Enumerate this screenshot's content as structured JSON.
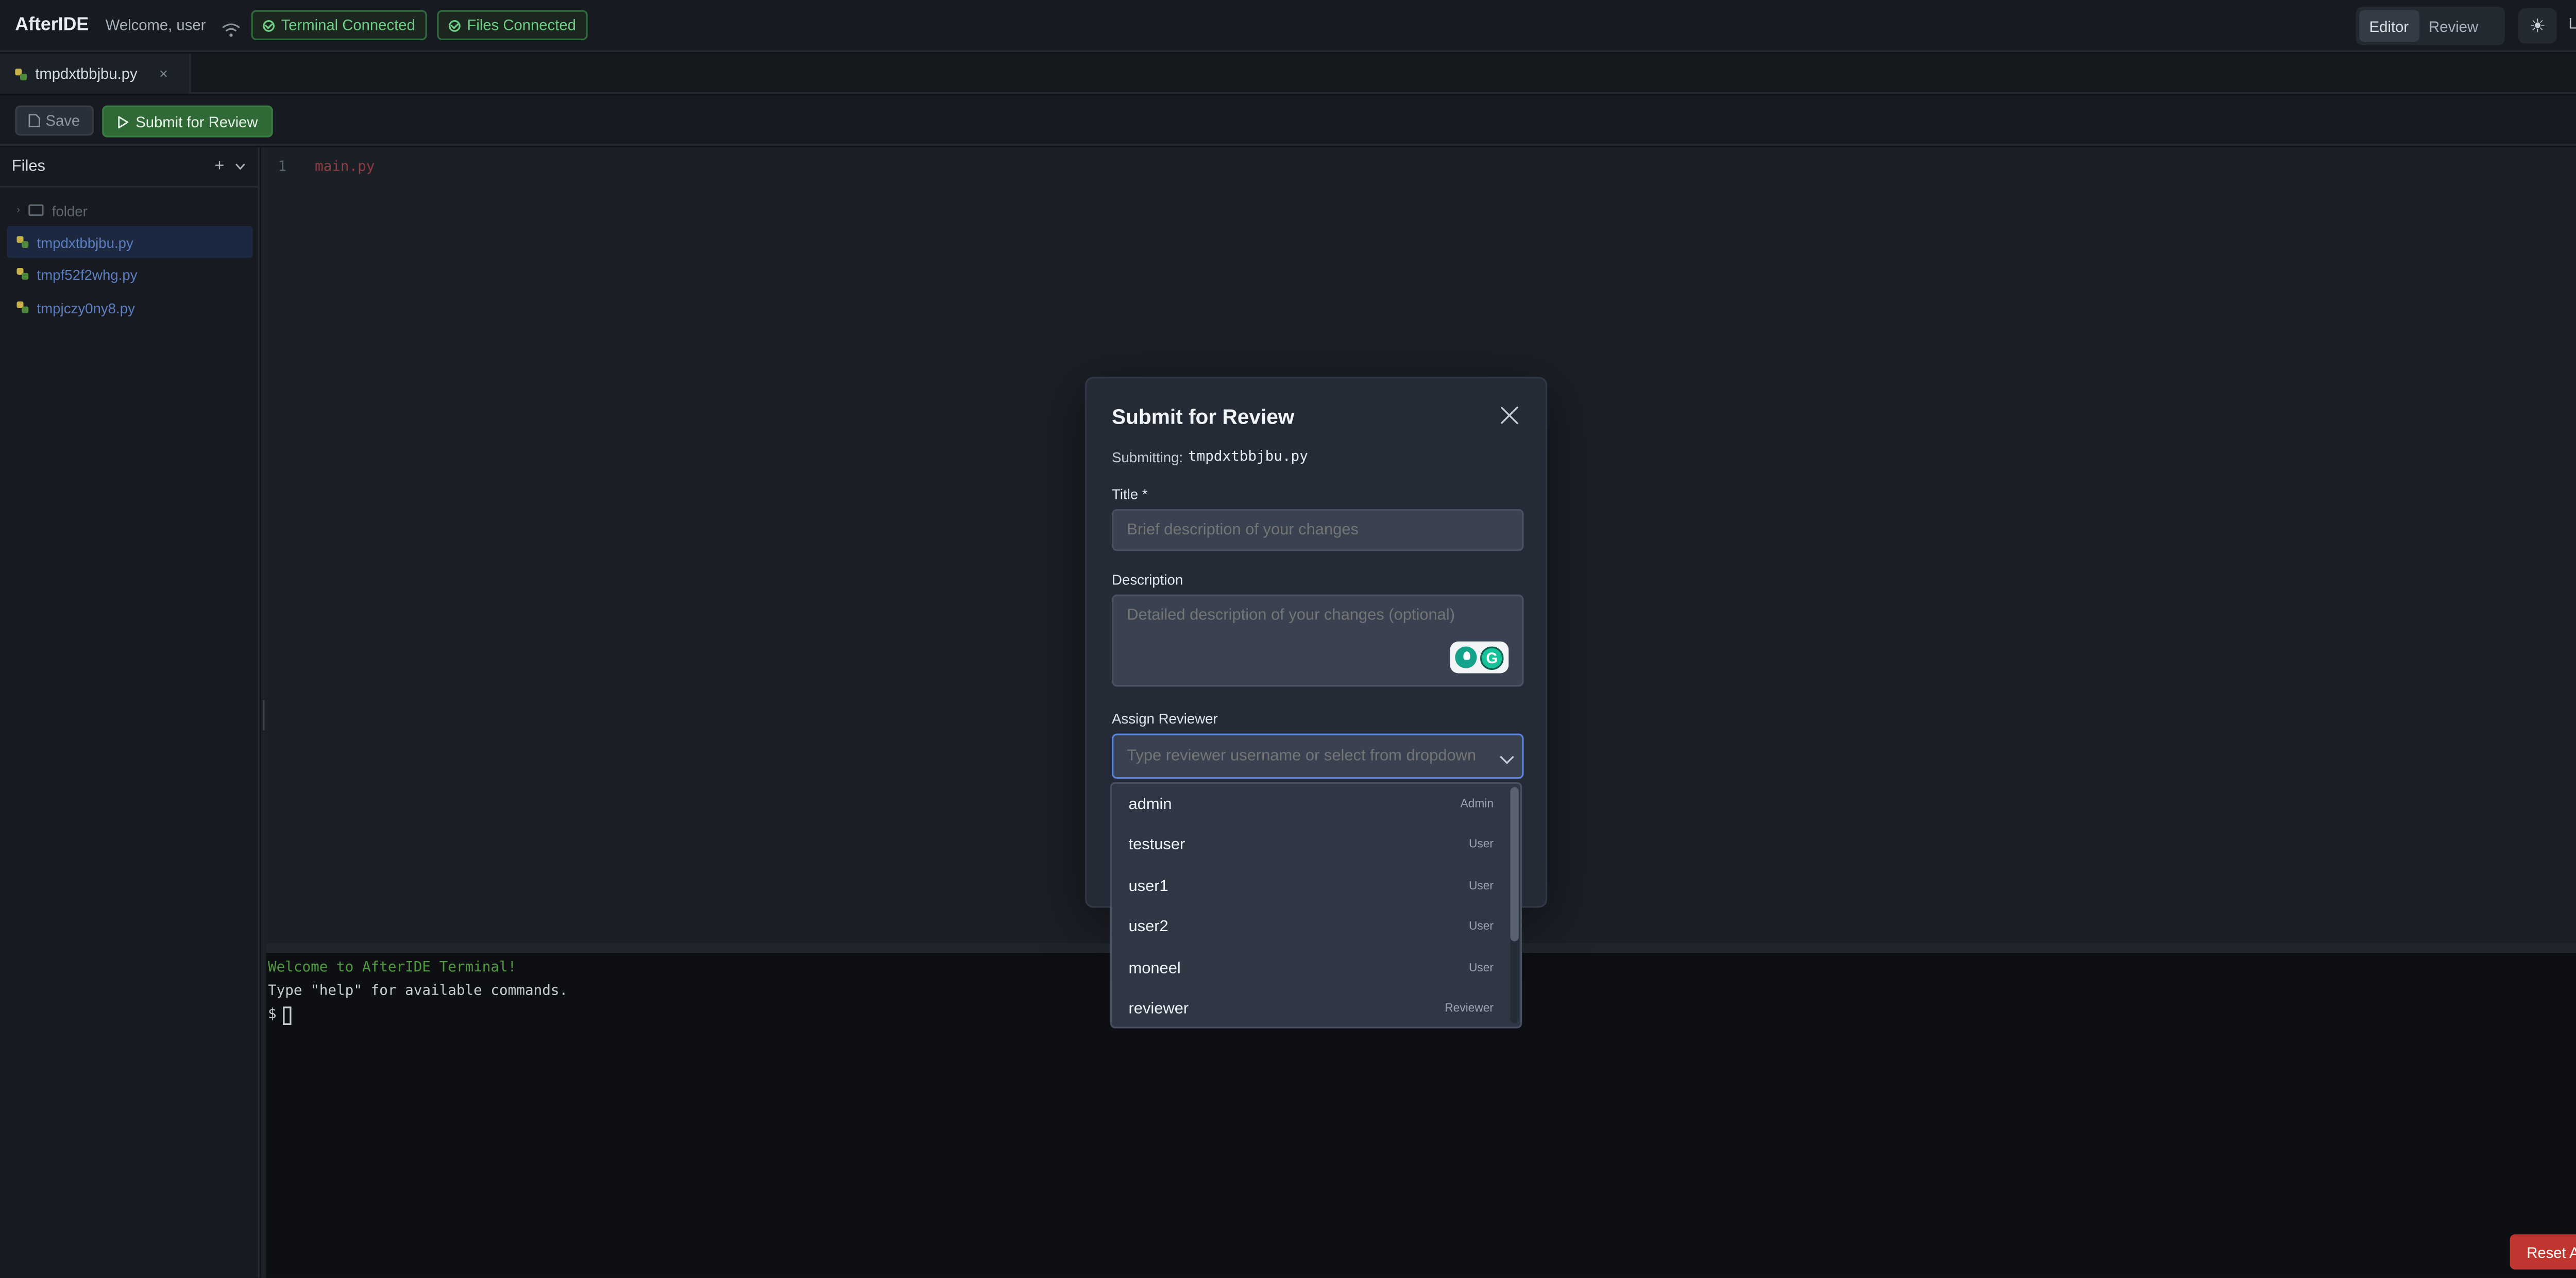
{
  "header": {
    "app_title": "AfterIDE",
    "welcome": "Welcome, user",
    "terminal_status": "Terminal Connected",
    "files_status": "Files Connected",
    "modes": [
      "Editor",
      "Review"
    ],
    "active_mode": "Editor",
    "logout": "Logout",
    "theme_icon": "sun-icon"
  },
  "tab": {
    "label": "tmpdxtbbjbu.py",
    "close": "×"
  },
  "toolbar": {
    "save_label": "Save",
    "submit_label": "Submit for Review"
  },
  "sidebar": {
    "title": "Files",
    "add": "+",
    "folder": "folder",
    "files": [
      "tmpdxtbbjbu.py",
      "tmpf52f2whg.py",
      "tmpjczy0ny8.py"
    ],
    "selected_file": "tmpdxtbbjbu.py"
  },
  "editor": {
    "line_number": "1",
    "code": "main.py"
  },
  "terminal": {
    "line1": "Welcome to AfterIDE Terminal!",
    "line2": "Type \"help\" for available commands.",
    "prompt": "$"
  },
  "reset_auth": "Reset Auth",
  "modal": {
    "title": "Submit for Review",
    "submitting_label": "Submitting:",
    "submitting_file": "tmpdxtbbjbu.py",
    "title_label": "Title *",
    "title_placeholder": "Brief description of your changes",
    "description_label": "Description",
    "description_placeholder": "Detailed description of your changes (optional)",
    "reviewer_label": "Assign Reviewer",
    "reviewer_placeholder": "Type reviewer username or select from dropdown"
  },
  "reviewers": [
    {
      "name": "admin",
      "role": "Admin"
    },
    {
      "name": "testuser",
      "role": "User"
    },
    {
      "name": "user1",
      "role": "User"
    },
    {
      "name": "user2",
      "role": "User"
    },
    {
      "name": "moneel",
      "role": "User"
    },
    {
      "name": "reviewer",
      "role": "Reviewer"
    }
  ],
  "colors": {
    "accent_green": "#2f6a36",
    "focus_blue": "#5b82d8",
    "danger_red": "#c0352f",
    "status_green": "#6fcf86"
  }
}
